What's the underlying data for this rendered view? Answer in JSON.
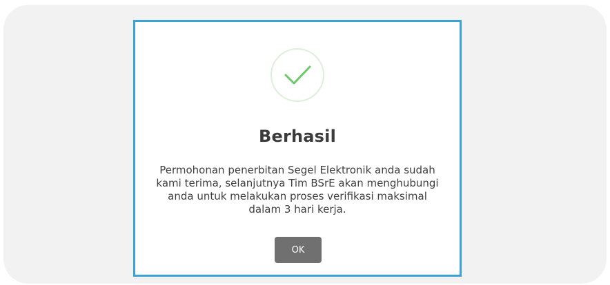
{
  "dialog": {
    "icon": "check-circle-icon",
    "title": "Berhasil",
    "message": "Permohonan penerbitan Segel Elektronik anda sudah kami terima, selanjutnya Tim BSrE akan menghubungi anda untuk melakukan proses verifikasi maksimal dalam 3 hari kerja.",
    "ok_label": "OK"
  },
  "colors": {
    "dialog_border": "#3aa3d4",
    "check": "#6cc86a",
    "check_circle": "#dcefd8",
    "button_bg": "#707070",
    "backdrop": "#f2f2f2"
  }
}
